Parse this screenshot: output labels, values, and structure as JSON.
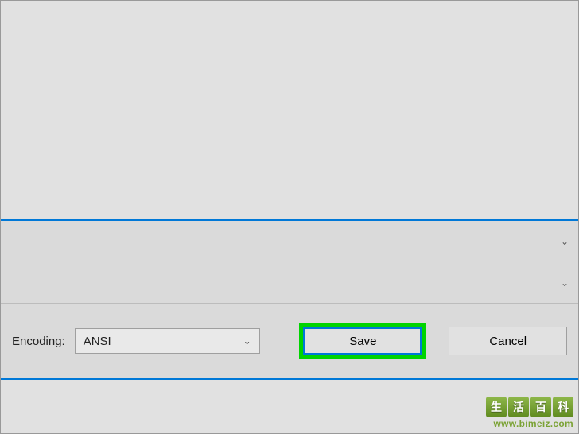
{
  "encoding": {
    "label": "Encoding:",
    "value": "ANSI"
  },
  "buttons": {
    "save": "Save",
    "cancel": "Cancel"
  },
  "watermark": {
    "chars": [
      "生",
      "活",
      "百",
      "科"
    ],
    "url": "www.bimeiz.com"
  }
}
